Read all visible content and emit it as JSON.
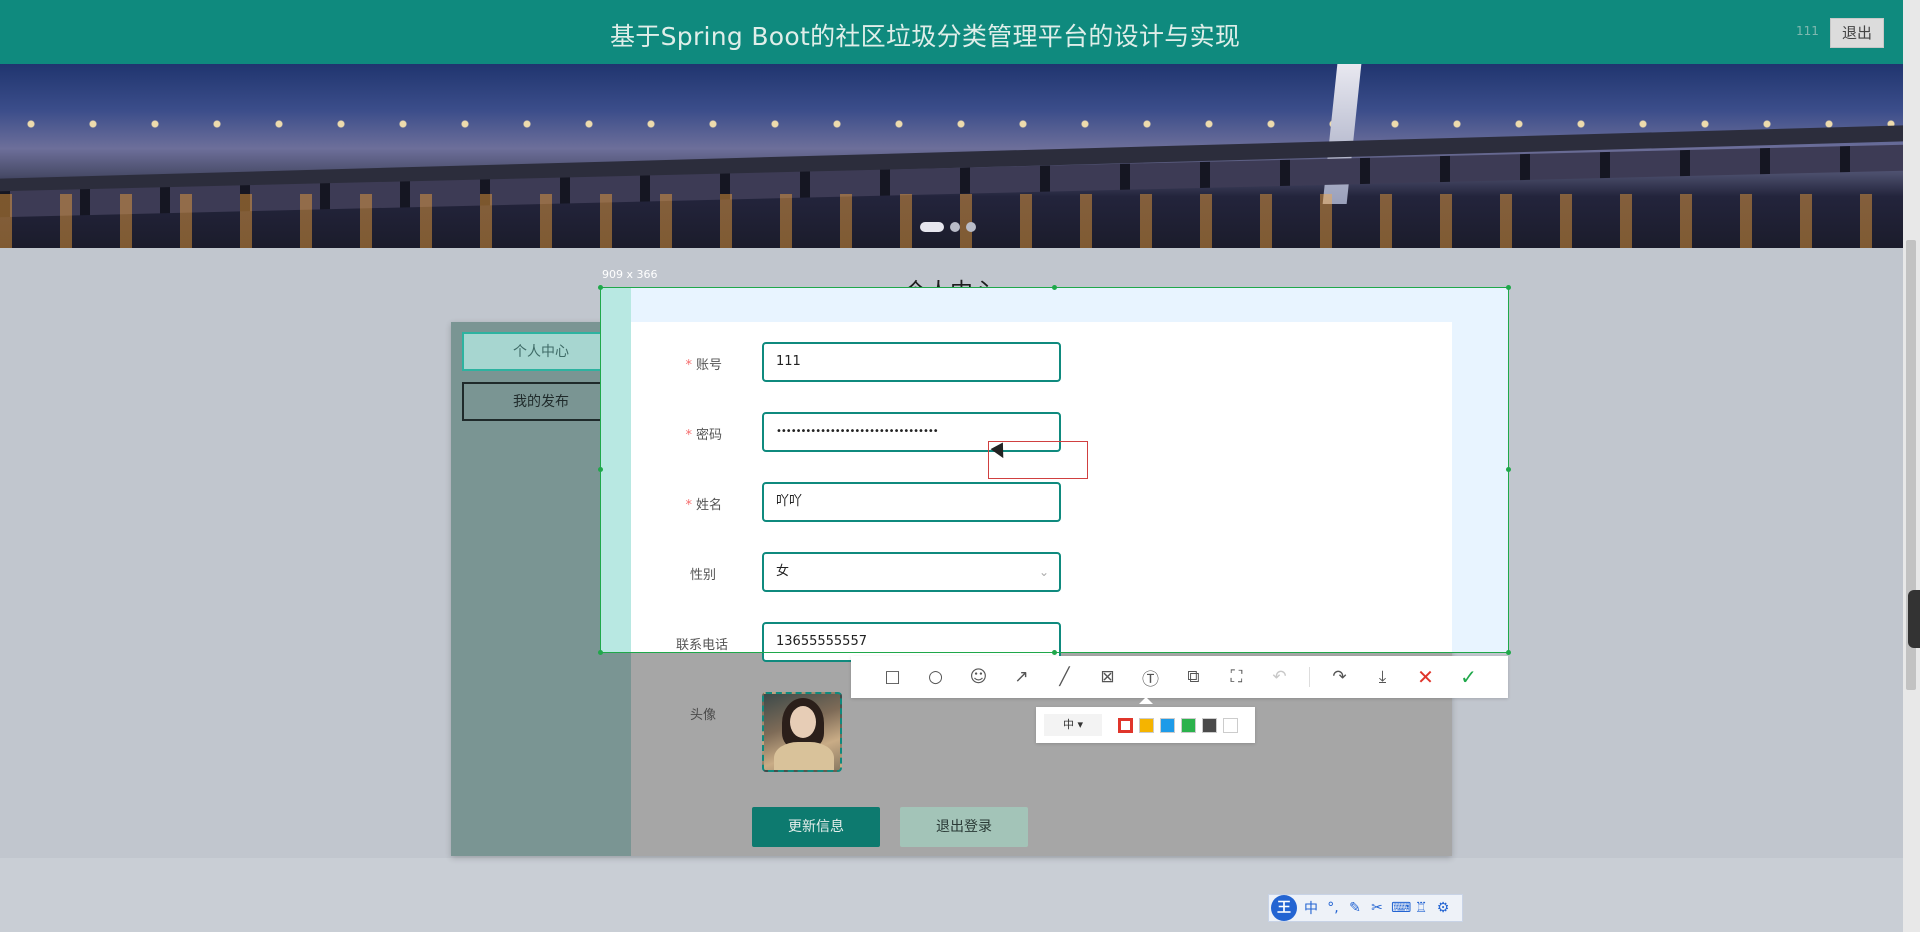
{
  "header": {
    "title": "基于Spring Boot的社区垃圾分类管理平台的设计与实现",
    "user_label": "111",
    "logout_label": "退出"
  },
  "banner": {
    "slides": 3,
    "active_slide": 1
  },
  "page": {
    "section_title": "个人中心"
  },
  "sidebar": {
    "items": [
      {
        "label": "个人中心",
        "active": true
      },
      {
        "label": "我的发布",
        "active": false
      }
    ]
  },
  "form": {
    "account": {
      "label": "账号",
      "value": "111",
      "required": true
    },
    "password": {
      "label": "密码",
      "value": "•••••••••••••••••••••••••••••••••",
      "required": true
    },
    "name": {
      "label": "姓名",
      "value": "吖吖",
      "required": true
    },
    "gender": {
      "label": "性别",
      "value": "女",
      "required": false
    },
    "phone": {
      "label": "联系电话",
      "value": "13655555557",
      "required": false
    },
    "avatar": {
      "label": "头像"
    },
    "update_button": "更新信息",
    "logout_button": "退出登录"
  },
  "screenshot_tool": {
    "dimension_label": "909 x 366",
    "size_option": "中 ▾",
    "colors": [
      "#e0352b",
      "#f5b400",
      "#1e9be8",
      "#2bb24c",
      "#4a4a4a",
      "#ffffff"
    ],
    "selected_color": "#e0352b"
  },
  "ime": {
    "logo": "王",
    "mode": "中"
  }
}
